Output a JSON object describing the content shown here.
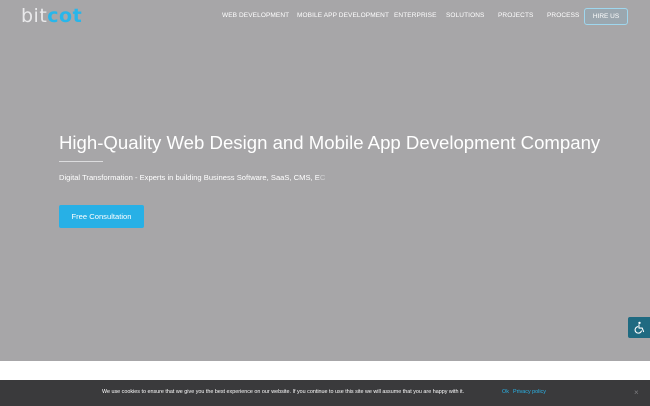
{
  "brand": {
    "logo_prefix": "bit",
    "logo_suffix": "cot",
    "accent_color": "#27b0e6"
  },
  "nav": {
    "items": [
      {
        "label": "WEB DEVELOPMENT"
      },
      {
        "label": "MOBILE APP DEVELOPMENT"
      },
      {
        "label": "ENTERPRISE"
      },
      {
        "label": "SOLUTIONS"
      },
      {
        "label": "PROJECTS"
      },
      {
        "label": "PROCESS"
      }
    ],
    "hire_label": "HIRE US"
  },
  "hero": {
    "headline": "High-Quality Web Design and Mobile App Development Company",
    "subline_main": "Digital Transformation - Experts in building Business Software, SaaS, CMS, E",
    "subline_fade": "C",
    "cta_label": "Free Consultation"
  },
  "accessibility": {
    "icon": "wheelchair-icon"
  },
  "cookie": {
    "text": "We use cookies to ensure that we give you the best experience on our website. If you continue to use this site we will assume that you are happy with it.",
    "ok_label": "Ok",
    "policy_label": "Privacy policy",
    "close_symbol": "×"
  }
}
